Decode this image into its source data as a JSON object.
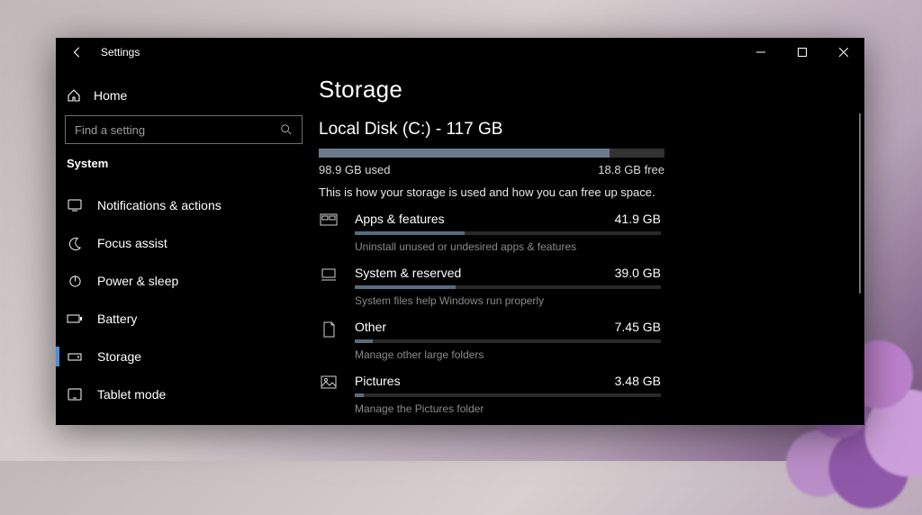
{
  "titlebar": {
    "title": "Settings"
  },
  "sidebar": {
    "home": "Home",
    "search_placeholder": "Find a setting",
    "section": "System",
    "items": [
      {
        "label": "Notifications & actions"
      },
      {
        "label": "Focus assist"
      },
      {
        "label": "Power & sleep"
      },
      {
        "label": "Battery"
      },
      {
        "label": "Storage"
      },
      {
        "label": "Tablet mode"
      }
    ]
  },
  "main": {
    "heading": "Storage",
    "disk_title": "Local Disk (C:) - 117 GB",
    "used": "98.9 GB used",
    "free": "18.8 GB free",
    "fill_pct": 84,
    "desc": "This is how your storage is used and how you can free up space.",
    "categories": [
      {
        "name": "Apps & features",
        "size": "41.9 GB",
        "pct": 36,
        "hint": "Uninstall unused or undesired apps & features"
      },
      {
        "name": "System & reserved",
        "size": "39.0 GB",
        "pct": 33,
        "hint": "System files help Windows run properly"
      },
      {
        "name": "Other",
        "size": "7.45 GB",
        "pct": 6,
        "hint": "Manage other large folders"
      },
      {
        "name": "Pictures",
        "size": "3.48 GB",
        "pct": 3,
        "hint": "Manage the Pictures folder"
      }
    ]
  }
}
